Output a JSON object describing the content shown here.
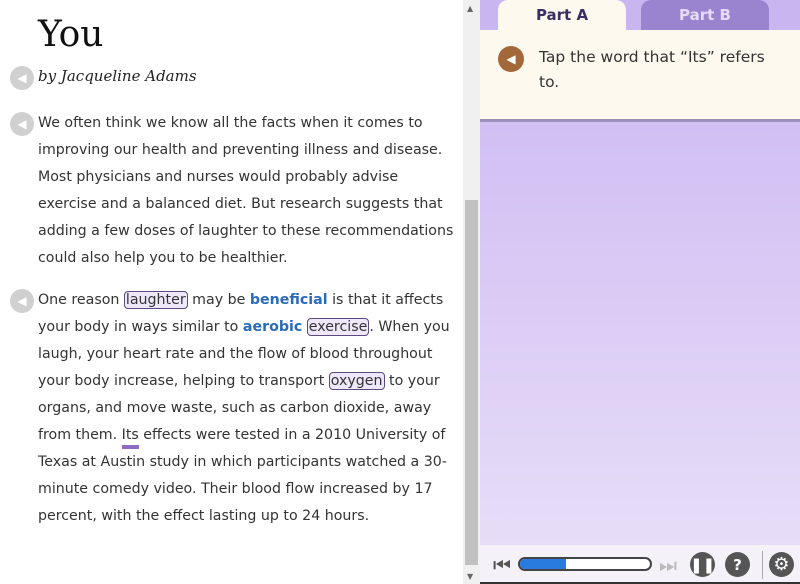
{
  "passage": {
    "title_visible": "You",
    "byline": "by Jacqueline Adams",
    "para1": [
      "We often think we know all the facts when it comes to",
      "improving our health and preventing illness and disease.",
      "Most physicians and nurses would probably advise",
      "exercise and a balanced diet. But research suggests that",
      "adding a few doses of laughter to these recommendations",
      "could also help you to be healthier."
    ],
    "para2": {
      "l1": [
        "One reason ",
        "laughter",
        " may be ",
        "beneficial",
        " is that it affects"
      ],
      "l2": [
        "your body in ways similar to ",
        "aerobic",
        " ",
        "exercise",
        ". When you"
      ],
      "l3": "laugh, your heart rate and the flow of blood throughout",
      "l4": [
        "your body increase, helping to transport ",
        "oxygen",
        " to your"
      ],
      "l5": "organs, and move waste, such as carbon dioxide, away",
      "l6": [
        "from them. ",
        "Its",
        " effects were tested in a 2010 University of"
      ],
      "l7": "Texas at Austin study in which participants watched a 30-",
      "l8": "minute comedy video. Their blood flow increased by 17",
      "l9": "percent, with the effect lasting up to 24 hours."
    }
  },
  "tabs": [
    {
      "label": "Part A",
      "active": true
    },
    {
      "label": "Part B",
      "active": false
    }
  ],
  "question": "Tap the word that “Its” refers to.",
  "player": {
    "progress_percent": 35
  },
  "colors": {
    "accent": "#8c6cc4",
    "keyword": "#2a6bb8",
    "progress": "#2a7be0"
  }
}
